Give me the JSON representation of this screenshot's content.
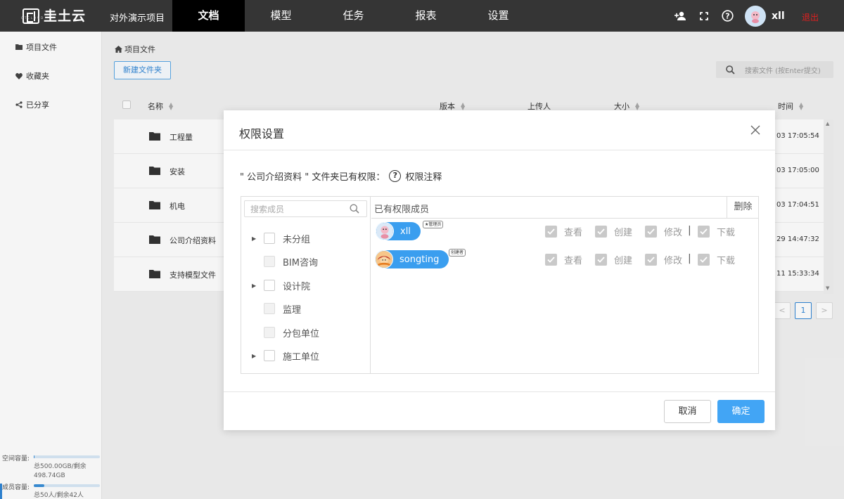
{
  "topbar": {
    "logo_text": "圭土云",
    "logo_sub": "GTCLOUD",
    "project_name": "对外演示项目",
    "nav": [
      "文档",
      "模型",
      "任务",
      "报表",
      "设置"
    ],
    "active_nav": "文档",
    "user_name": "xll",
    "logout_label": "退出",
    "icons": [
      "add-user-icon",
      "fullscreen-icon",
      "help-icon"
    ]
  },
  "sidebar": {
    "items": [
      {
        "label": "项目文件",
        "icon": "folder-icon"
      },
      {
        "label": "收藏夹",
        "icon": "heart-icon"
      },
      {
        "label": "已分享",
        "icon": "share-icon"
      }
    ],
    "space": {
      "label": "空间容量:",
      "text": "总500.00GB/剩余498.74GB",
      "fraction": 0.0025
    },
    "members": {
      "label": "成员容量:",
      "text": "总50人/剩余42人",
      "fraction": 0.16
    }
  },
  "main": {
    "breadcrumb": "项目文件",
    "new_folder_label": "新建文件夹",
    "search_placeholder": "搜索文件 (按Enter提交)",
    "columns": {
      "name": "名称",
      "version": "版本",
      "uploader": "上传人",
      "size": "大小",
      "time": "时间"
    },
    "rows": [
      {
        "name": "工程量",
        "time": "03 17:05:54"
      },
      {
        "name": "安装",
        "time": "03 17:05:00"
      },
      {
        "name": "机电",
        "time": "03 17:04:51"
      },
      {
        "name": "公司介绍资料",
        "time": "29 14:47:32"
      },
      {
        "name": "支持模型文件",
        "time": "11 15:33:34"
      }
    ],
    "pagination": {
      "prev": "<",
      "current": "1",
      "next": ">"
    }
  },
  "modal": {
    "title": "权限设置",
    "note_prefix": "\" 公司介绍资料 \" 文件夹已有权限：",
    "note_link": "权限注释",
    "member_search_placeholder": "搜索成员",
    "tree": [
      {
        "label": "未分组",
        "expandable": true,
        "disabled": false
      },
      {
        "label": "BIM咨询",
        "expandable": false,
        "disabled": true
      },
      {
        "label": "设计院",
        "expandable": true,
        "disabled": false
      },
      {
        "label": "监理",
        "expandable": false,
        "disabled": true
      },
      {
        "label": "分包单位",
        "expandable": false,
        "disabled": true
      },
      {
        "label": "施工单位",
        "expandable": true,
        "disabled": false
      }
    ],
    "members_header": "已有权限成员",
    "delete_header": "删除",
    "members": [
      {
        "name": "xll",
        "role": "★管理员",
        "permissions": [
          "查看",
          "创建",
          "修改",
          "下载"
        ]
      },
      {
        "name": "songting",
        "role": "创建者",
        "permissions": [
          "查看",
          "创建",
          "修改",
          "下载"
        ]
      }
    ],
    "cancel_label": "取消",
    "ok_label": "确定"
  }
}
